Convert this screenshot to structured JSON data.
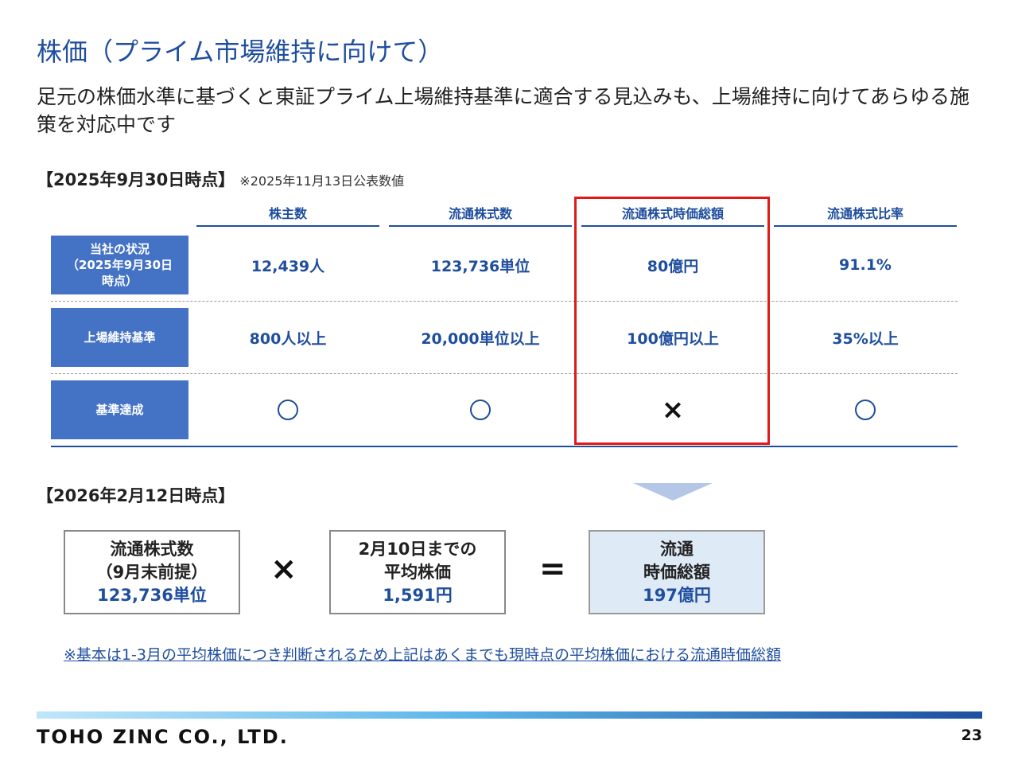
{
  "title": "株価（プライム市場維持に向けて）",
  "subtitle": "足元の株価水準に基づくと東証プライム上場維持基準に適合する見込みも、上場維持に向けてあらゆる施策を対応中です",
  "section1": {
    "heading": "【2025年9月30日時点】",
    "note": "※2025年11月13日公表数値"
  },
  "table": {
    "columns": [
      "株主数",
      "流通株式数",
      "流通株式時価総額",
      "流通株式比率"
    ],
    "rows": [
      {
        "label": "当社の状況\n（2025年9月30日\n時点）",
        "cells": [
          "12,439人",
          "123,736単位",
          "80億円",
          "91.1%"
        ]
      },
      {
        "label": "上場維持基準",
        "cells": [
          "800人以上",
          "20,000単位以上",
          "100億円以上",
          "35%以上"
        ]
      },
      {
        "label": "基準達成",
        "cells": [
          "circle-icon",
          "circle-icon",
          "×",
          "circle-icon"
        ]
      }
    ]
  },
  "section2": {
    "heading": "【2026年2月12日時点】"
  },
  "formula": {
    "box1": {
      "line1": "流通株式数",
      "line2": "（9月末前提）",
      "value": "123,736単位"
    },
    "op1": "×",
    "box2": {
      "line1": "2月10日までの",
      "line2": "平均株価",
      "value": "1,591円"
    },
    "op2": "=",
    "box3": {
      "line1": "流通",
      "line2": "時価総額",
      "value": "197億円"
    }
  },
  "footnote": "※基本は1-3月の平均株価につき判断されるため上記はあくまでも現時点の平均株価における流通時価総額",
  "footer": {
    "company": "TOHO ZINC CO., LTD.",
    "page": "23"
  },
  "colors": {
    "brand_blue": "#1f4e9e",
    "label_blue": "#4472c4",
    "highlight_red": "#e01a1a",
    "result_bg": "#deebf7"
  }
}
